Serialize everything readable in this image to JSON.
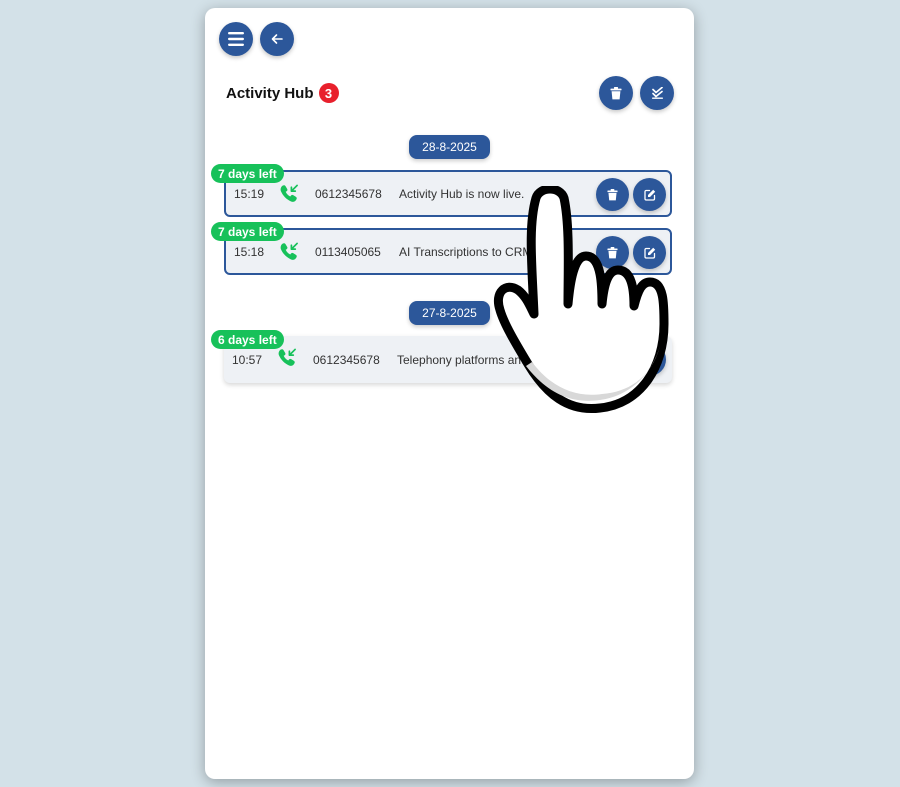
{
  "header": {
    "menu_icon": "hamburger-menu-icon",
    "back_icon": "arrow-left-icon",
    "title": "Activity Hub",
    "badge_count": "3",
    "delete_all_icon": "trash-icon",
    "mark_all_read_icon": "double-check-icon"
  },
  "groups": [
    {
      "date": "28-8-2025",
      "items": [
        {
          "days_left": "7 days left",
          "time": "15:19",
          "call_icon": "incoming-call-icon",
          "phone": "0612345678",
          "message": "Activity Hub is now live."
        },
        {
          "days_left": "7 days left",
          "time": "15:18",
          "call_icon": "incoming-call-icon",
          "phone": "0113405065",
          "message": "AI Transcriptions to CRM – s"
        }
      ]
    },
    {
      "date": "27-8-2025",
      "items": [
        {
          "days_left": "6 days left",
          "time": "10:57",
          "call_icon": "incoming-call-icon",
          "phone": "0612345678",
          "message": "Telephony platforms and"
        }
      ]
    }
  ],
  "colors": {
    "background": "#d3e1e8",
    "primary": "#2c579a",
    "days_badge": "#17c15a",
    "count_badge": "#e8202c",
    "call_icon": "#17c15a"
  },
  "overlay": {
    "pointer_icon": "hand-pointer-icon"
  }
}
